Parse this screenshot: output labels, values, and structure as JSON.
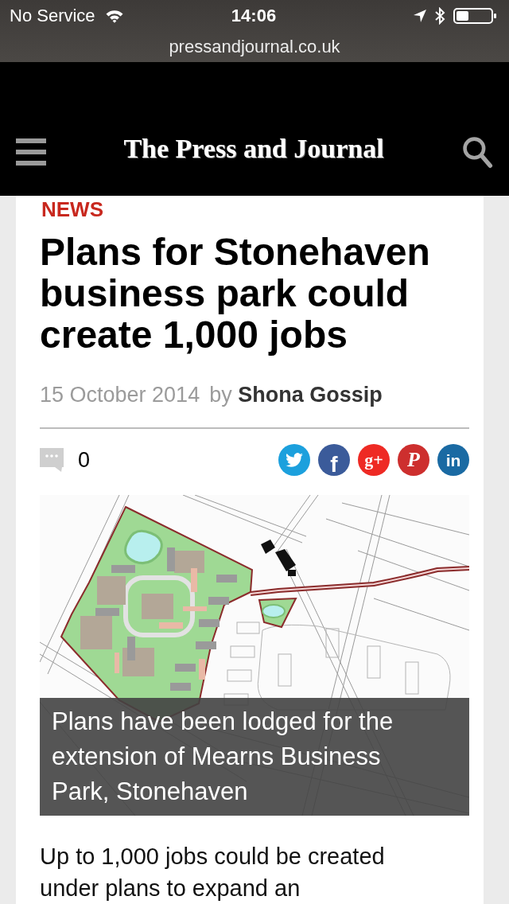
{
  "status_bar": {
    "carrier": "No Service",
    "time": "14:06",
    "url": "pressandjournal.co.uk"
  },
  "header": {
    "logo": "The Press and Journal"
  },
  "article": {
    "section": "NEWS",
    "headline": "Plans for Stonehaven business park could create 1,000 jobs",
    "date": "15 October 2014",
    "byline": "by **Shona Gossip**",
    "comment_count": "0",
    "share_buttons": [
      {
        "kind": "twitter",
        "color": "#1ca0dd"
      },
      {
        "kind": "facebook",
        "color": "#3b5b9a",
        "glyph": "f"
      },
      {
        "kind": "google_plus",
        "color": "#ee2a24",
        "glyph": "g+"
      },
      {
        "kind": "pinterest",
        "color": "#cd2f2e",
        "glyph": "P"
      },
      {
        "kind": "linkedin",
        "color": "#1a6aa3",
        "glyph": "in"
      }
    ],
    "image": {
      "caption": "Plans have been lodged for the extension of Mearns Business Park, Stonehaven"
    },
    "body": "Up to 1,000 jobs could be created under plans to expand an"
  }
}
